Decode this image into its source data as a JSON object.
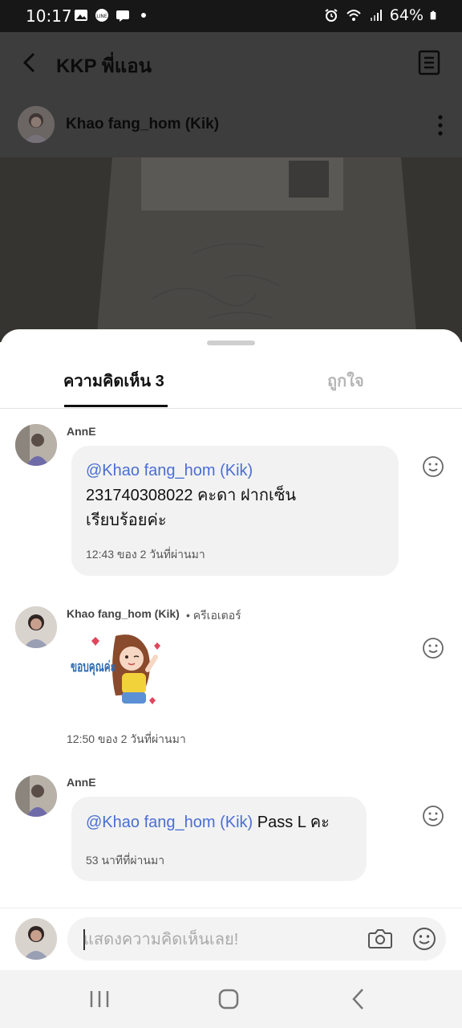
{
  "status_bar": {
    "time": "10:17",
    "battery": "64%"
  },
  "header": {
    "title": "KKP พี่แอน"
  },
  "post": {
    "author_name": "Khao fang_hom (Kik)"
  },
  "tabs": [
    {
      "label": "ความคิดเห็น 3"
    },
    {
      "label": "ถูกใจ"
    }
  ],
  "comments": [
    {
      "author": "AnnE",
      "mention": "@Khao fang_hom (Kik)",
      "text_line1": "231740308022 คะดา ฝากเซ็น",
      "text_line2": "เรียบร้อยค่ะ",
      "time": "12:43 ของ 2 วันที่ผ่านมา"
    },
    {
      "author": "Khao fang_hom (Kik)",
      "role": "• ครีเอเตอร์",
      "sticker_text": "ขอบคุณค่ะ",
      "time": "12:50 ของ 2 วันที่ผ่านมา"
    },
    {
      "author": "AnnE",
      "mention": "@Khao fang_hom (Kik)",
      "text": " Pass L คะ",
      "time": "53 นาทีที่ผ่านมา"
    }
  ],
  "composer": {
    "placeholder": "แสดงความคิดเห็นเลย!"
  },
  "colors": {
    "mention": "#4a6fd1",
    "status_bar": "#171717",
    "dim_overlay": "#3d3d3d"
  }
}
